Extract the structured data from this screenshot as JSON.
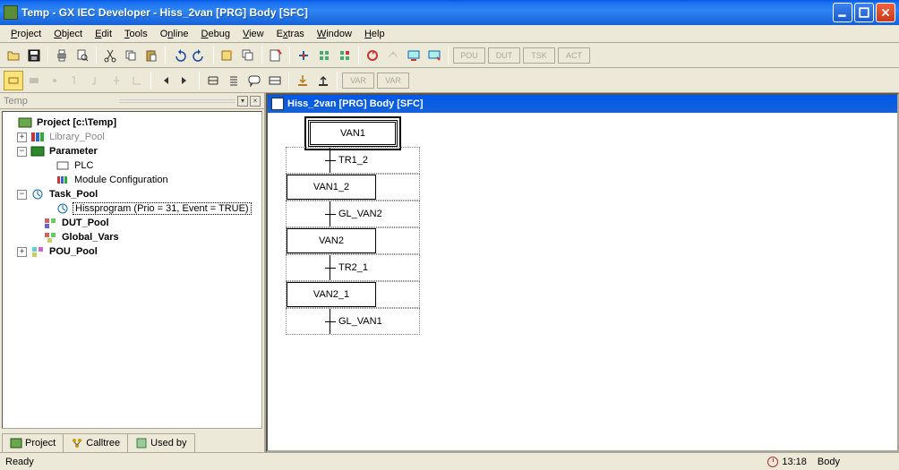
{
  "window": {
    "title": "Temp - GX IEC Developer - Hiss_2van [PRG] Body [SFC]"
  },
  "menu": [
    "Project",
    "Object",
    "Edit",
    "Tools",
    "Online",
    "Debug",
    "View",
    "Extras",
    "Window",
    "Help"
  ],
  "sidebar": {
    "header": "Temp",
    "root": "Project [c:\\Temp]",
    "nodes": {
      "lib": "Library_Pool",
      "param": "Parameter",
      "plc": "PLC",
      "modconf": "Module Configuration",
      "taskpool": "Task_Pool",
      "hiss": "Hissprogram (Prio = 31, Event = TRUE)",
      "dut": "DUT_Pool",
      "glob": "Global_Vars",
      "pou": "POU_Pool"
    },
    "tabs": [
      "Project",
      "Calltree",
      "Used by"
    ]
  },
  "editor": {
    "title": "Hiss_2van [PRG] Body [SFC]",
    "steps": [
      "VAN1",
      "TR1_2",
      "VAN1_2",
      "GL_VAN2",
      "VAN2",
      "TR2_1",
      "VAN2_1",
      "GL_VAN1"
    ]
  },
  "status": {
    "left": "Ready",
    "time": "13:18",
    "mode": "Body"
  }
}
